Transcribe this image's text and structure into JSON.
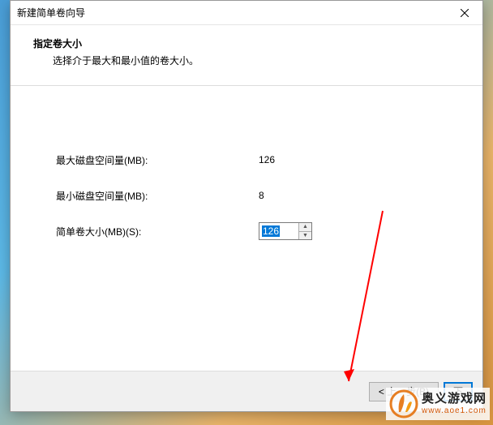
{
  "dialog": {
    "title": "新建简单卷向导",
    "close_icon": "close"
  },
  "header": {
    "title": "指定卷大小",
    "subtitle": "选择介于最大和最小值的卷大小。"
  },
  "fields": {
    "max_label": "最大磁盘空间量(MB):",
    "max_value": "126",
    "min_label": "最小磁盘空间量(MB):",
    "min_value": "8",
    "size_label": "简单卷大小(MB)(S):",
    "size_value": "126"
  },
  "footer": {
    "back_label": "< 上一步(B)",
    "next_label": "下"
  },
  "watermark": {
    "cn": "奥义游戏网",
    "en": "www.aoe1.com"
  }
}
